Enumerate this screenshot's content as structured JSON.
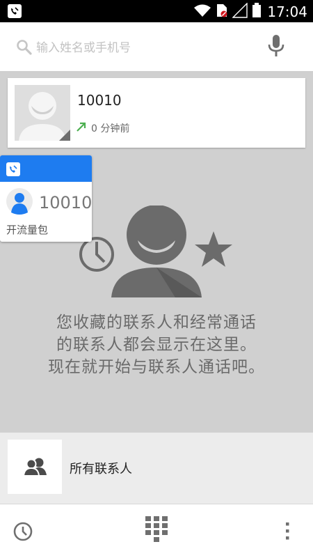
{
  "status_bar": {
    "time": "17:04",
    "icons": [
      "dialer-notification-icon",
      "wifi-icon",
      "sim-icon",
      "signal-icon",
      "battery-icon"
    ]
  },
  "search": {
    "placeholder": "输入姓名或手机号",
    "value": "",
    "icons": [
      "search-icon",
      "mic-icon"
    ]
  },
  "recent_call": {
    "name": "10010",
    "time_ago": "0 分钟前",
    "call_direction_icon": "outgoing-arrow-icon"
  },
  "popup": {
    "number": "10010",
    "label": "开流量包",
    "header_icon": "dialer-app-icon",
    "header_color": "#1e7cf0"
  },
  "empty_state": {
    "lines": [
      "您收藏的联系人和经常通话",
      "的联系人都会显示在这里。",
      "现在就开始与联系人通话吧。"
    ],
    "icons": [
      "clock-icon",
      "person-icon",
      "star-icon"
    ]
  },
  "all_contacts": {
    "label": "所有联系人",
    "icon": "contacts-icon"
  },
  "bottom_bar": {
    "icons": [
      "recent-calls-icon",
      "dialpad-icon",
      "overflow-menu-icon"
    ]
  }
}
